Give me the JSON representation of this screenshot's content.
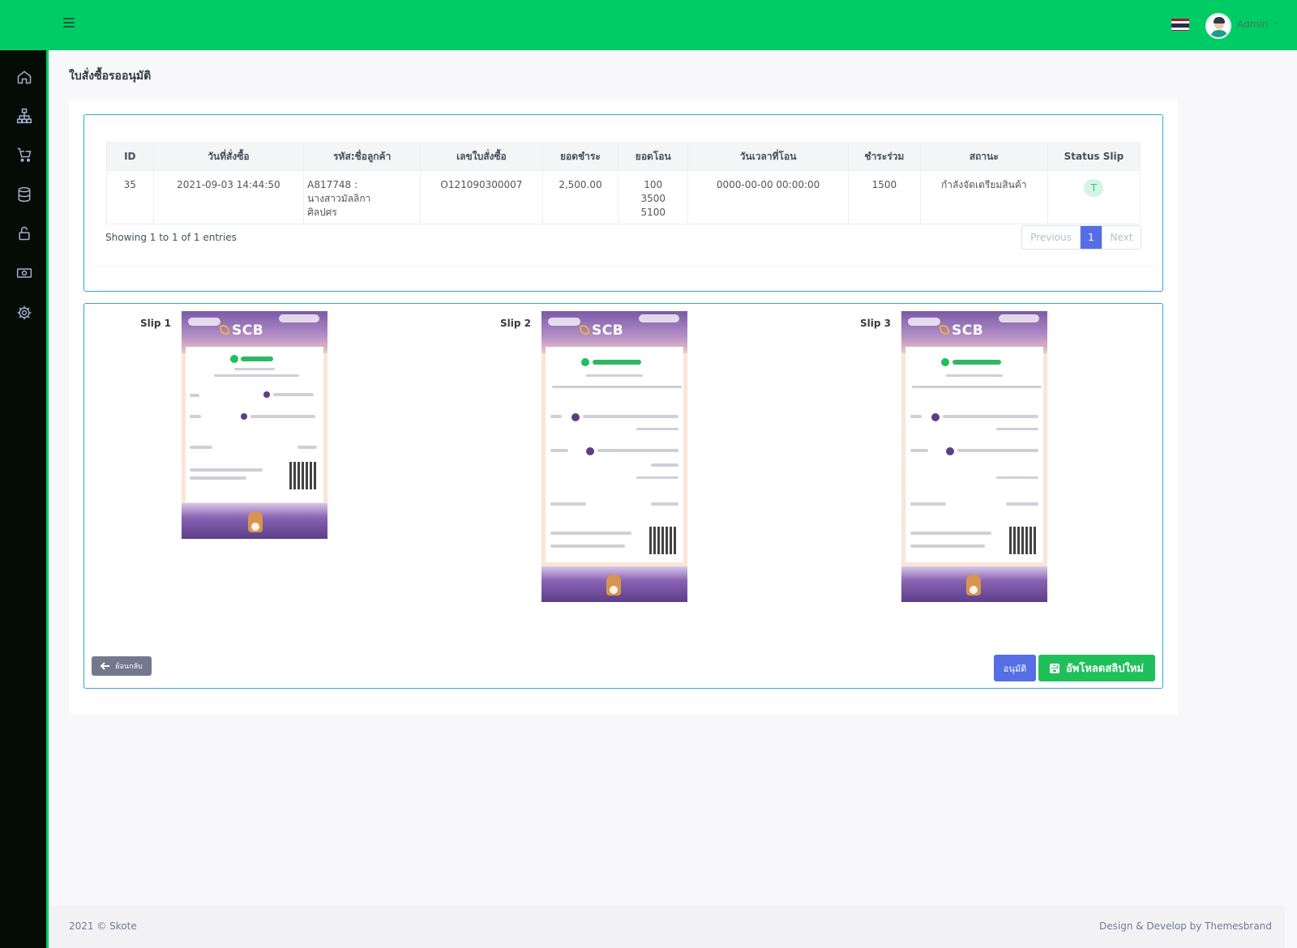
{
  "header": {
    "user_name": "Admin",
    "flag": "thai-flag",
    "accent_color": "#00cc66"
  },
  "sidebar": {
    "items": [
      {
        "icon": "home-icon"
      },
      {
        "icon": "sitemap-icon"
      },
      {
        "icon": "cart-plus-icon"
      },
      {
        "icon": "database-icon"
      },
      {
        "icon": "lock-icon"
      },
      {
        "icon": "money-icon"
      },
      {
        "icon": "gear-icon"
      }
    ]
  },
  "page": {
    "title": "ใบสั่งซื้อรออนุมัติ"
  },
  "table": {
    "headers": [
      "ID",
      "วันที่สั่งซื้อ",
      "รหัส:ชื่อลูกค้า",
      "เลขใบสั่งซื้อ",
      "ยอดชำระ",
      "ยอดโอน",
      "วันเวลาที่โอน",
      "ชำระร่วม",
      "สถานะ",
      "Status Slip"
    ],
    "rows": [
      {
        "id": "35",
        "order_date": "2021-09-03 14:44:50",
        "customer_1": "A817748 :",
        "customer_2": "นางสาวมัลลิกา",
        "customer_3": "ศิลปศร",
        "order_no": "O121090300007",
        "amount_due": "2,500.00",
        "transfer_1": "100",
        "transfer_2": "3500",
        "transfer_3": "5100",
        "transfer_time": "0000-00-00 00:00:00",
        "joint_payment": "1500",
        "status": "กำลังจัดเตรียมสินค้า",
        "status_slip": "T"
      }
    ],
    "showing": "Showing 1 to 1 of 1 entries",
    "pagination": {
      "previous": "Previous",
      "current": "1",
      "next": "Next"
    }
  },
  "slips": [
    {
      "label": "Slip 1",
      "bank": "SCB"
    },
    {
      "label": "Slip 2",
      "bank": "SCB"
    },
    {
      "label": "Slip 3",
      "bank": "SCB"
    }
  ],
  "actions": {
    "back": "ย้อนกลับ",
    "approve": "อนุมัติ",
    "upload": "อัพโหลดสลิปใหม่"
  },
  "footer": {
    "left": "2021 © Skote",
    "right": "Design & Develop by Themesbrand"
  }
}
